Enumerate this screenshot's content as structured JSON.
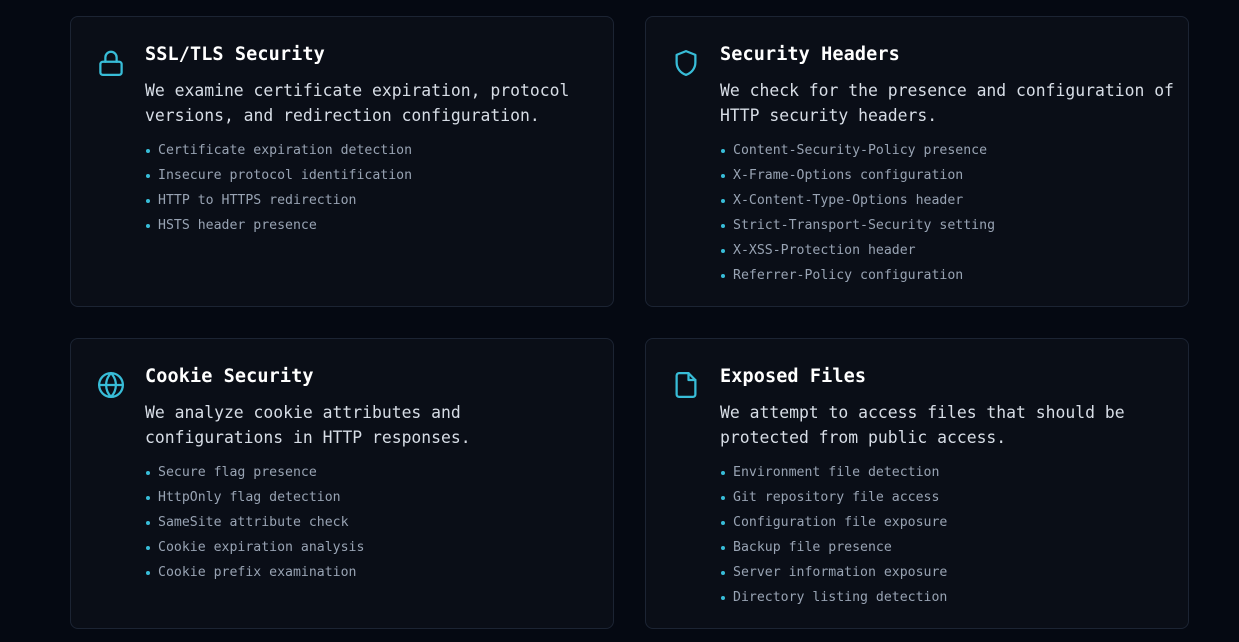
{
  "accent_color": "#38bdd8",
  "cards": [
    {
      "icon": "lock-icon",
      "title": "SSL/TLS Security",
      "description_lines": [
        "We examine certificate expiration, protocol",
        "versions, and redirection configuration."
      ],
      "items": [
        "Certificate expiration detection",
        "Insecure protocol identification",
        "HTTP to HTTPS redirection",
        "HSTS header presence"
      ]
    },
    {
      "icon": "shield-icon",
      "title": "Security Headers",
      "description_lines": [
        "We check for the presence and configuration of",
        "HTTP security headers."
      ],
      "items": [
        "Content-Security-Policy presence",
        "X-Frame-Options configuration",
        "X-Content-Type-Options header",
        "Strict-Transport-Security setting",
        "X-XSS-Protection header",
        "Referrer-Policy configuration"
      ]
    },
    {
      "icon": "globe-icon",
      "title": "Cookie Security",
      "description_lines": [
        "We analyze cookie attributes and",
        "configurations in HTTP responses."
      ],
      "items": [
        "Secure flag presence",
        "HttpOnly flag detection",
        "SameSite attribute check",
        "Cookie expiration analysis",
        "Cookie prefix examination"
      ]
    },
    {
      "icon": "file-icon",
      "title": "Exposed Files",
      "description_lines": [
        "We attempt to access files that should be",
        "protected from public access."
      ],
      "items": [
        "Environment file detection",
        "Git repository file access",
        "Configuration file exposure",
        "Backup file presence",
        "Server information exposure",
        "Directory listing detection"
      ]
    }
  ]
}
